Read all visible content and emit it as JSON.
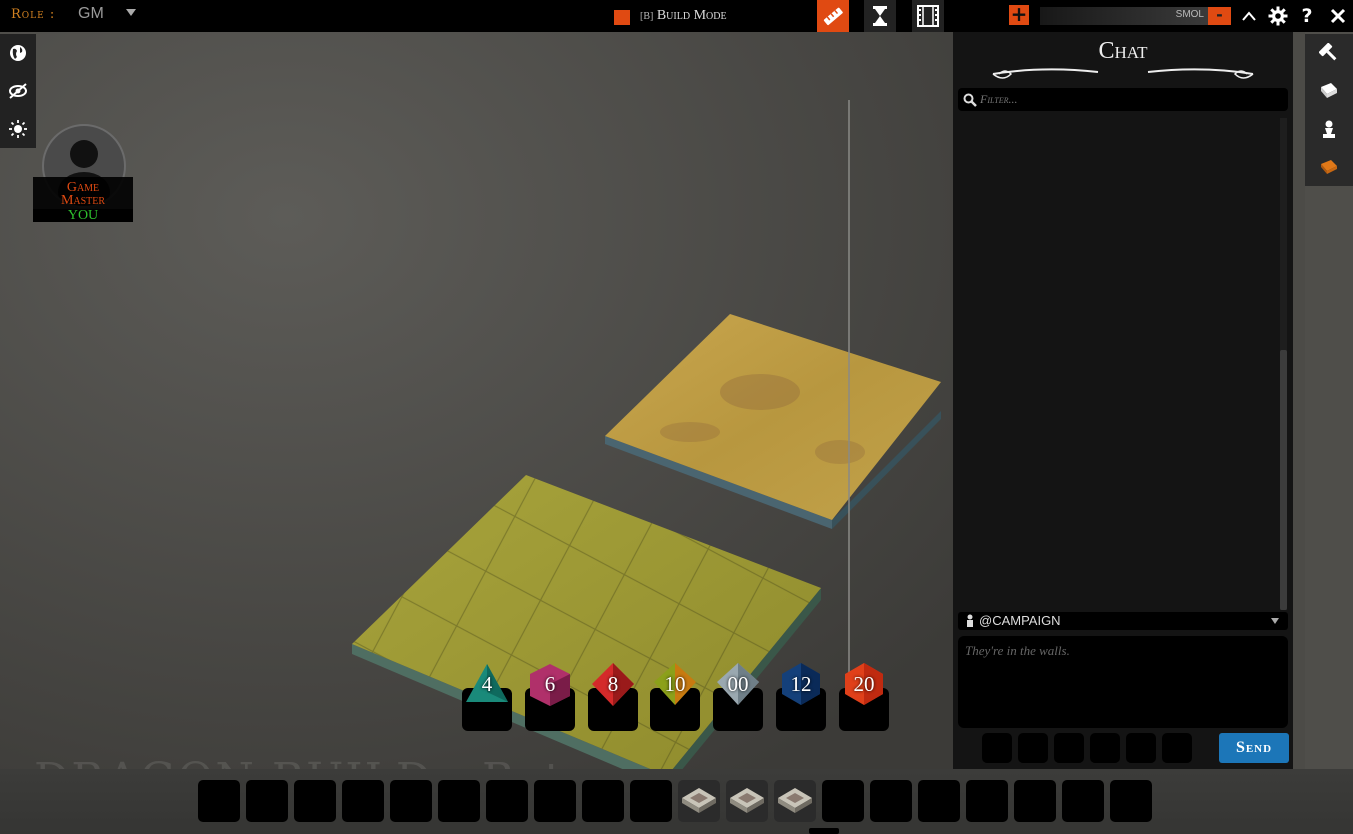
{
  "topbar": {
    "role_label": "Role :",
    "role_value": "GM",
    "build_key": "[B]",
    "build_label": "Build Mode",
    "zoom_label": "SMOL",
    "zoom_in": "+",
    "zoom_out": "-"
  },
  "avatar": {
    "line1": "Game",
    "line2": "Master",
    "player": "YOU"
  },
  "dice": [
    "4",
    "6",
    "8",
    "10",
    "00",
    "12",
    "20"
  ],
  "watermark": "DRAGON BUILD - Beta",
  "chat": {
    "title": "Chat",
    "filter_placeholder": "Filter...",
    "channel": "@CAMPAIGN",
    "input_placeholder": "They're in the walls.",
    "send_label": "Send"
  },
  "colors": {
    "accent": "#e04a12",
    "send": "#1c76b8",
    "player_name": "#2ec02e"
  },
  "icons": {
    "left_toolbar": [
      "globe-icon",
      "visibility-off-icon",
      "sun-icon"
    ],
    "right_toolbar": [
      "hammer-icon",
      "book-icon",
      "pawn-icon",
      "journal-icon"
    ],
    "topbar": [
      "ruler-icon",
      "hourglass-icon",
      "film-icon",
      "plus-icon",
      "minus-icon",
      "chevron-up-icon",
      "gear-icon",
      "help-icon",
      "close-icon"
    ]
  }
}
